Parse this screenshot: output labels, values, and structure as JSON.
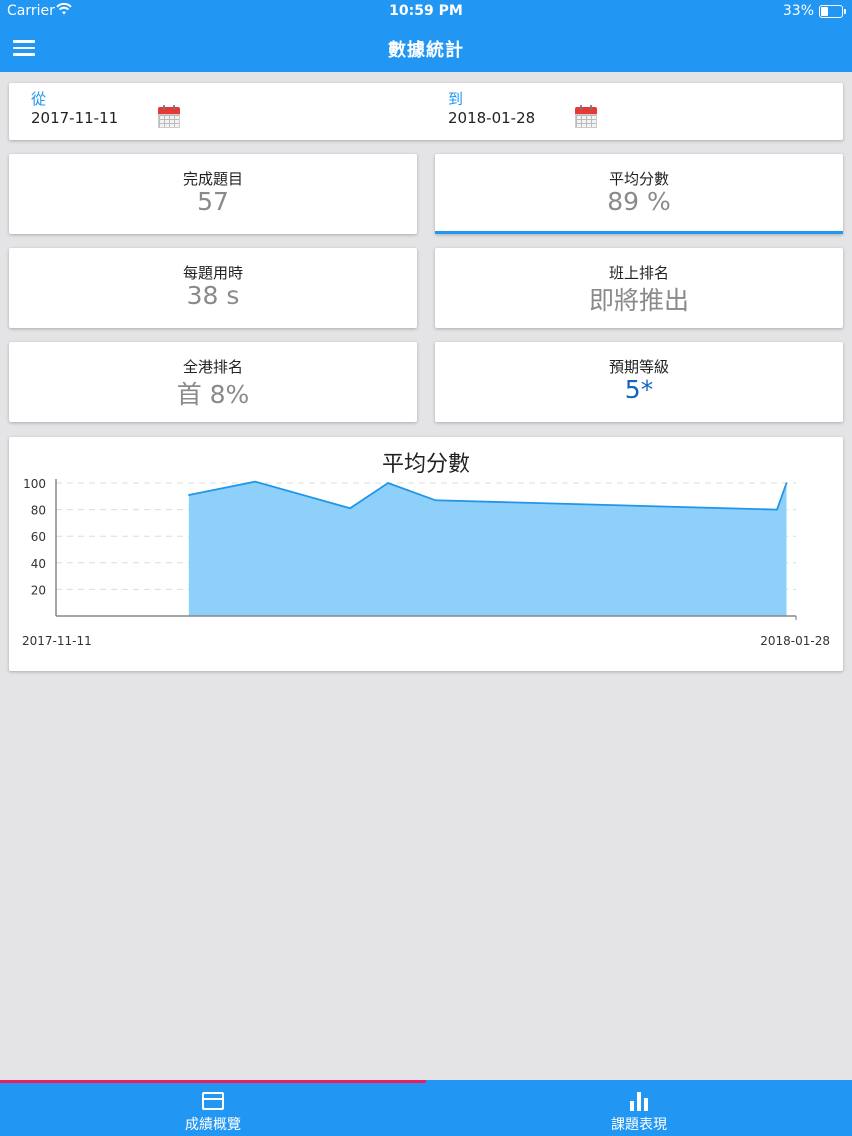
{
  "status_bar": {
    "carrier": "Carrier",
    "time": "10:59 PM",
    "battery": "33%"
  },
  "header": {
    "title": "數據統計"
  },
  "date_range": {
    "from_label": "從",
    "from_value": "2017-11-11",
    "to_label": "到",
    "to_value": "2018-01-28"
  },
  "stats": [
    {
      "label": "完成題目",
      "value": "57"
    },
    {
      "label": "平均分數",
      "value": "89 %"
    },
    {
      "label": "每題用時",
      "value": "38 s"
    },
    {
      "label": "班上排名",
      "value": "即將推出"
    },
    {
      "label": "全港排名",
      "value": "首 8%"
    },
    {
      "label": "預期等級",
      "value": "5*"
    }
  ],
  "colors": {
    "primary": "#2196f3",
    "tab_indicator": "#e91e63",
    "area_fill": "#8ed0fa",
    "area_line": "#2196e8",
    "grade_blue": "#1565c0"
  },
  "chart_data": {
    "type": "area",
    "title": "平均分數",
    "x_start_label": "2017-11-11",
    "x_end_label": "2018-01-28",
    "x": [
      "2017-11-25",
      "2017-12-02",
      "2017-12-12",
      "2017-12-16",
      "2017-12-21",
      "2018-01-26",
      "2018-01-27"
    ],
    "y": [
      91,
      101,
      81,
      100,
      87,
      80,
      100
    ],
    "y_ticks": [
      20,
      40,
      60,
      80,
      100
    ],
    "ylim": [
      0,
      100
    ],
    "grid": "horizontal dashed"
  },
  "tabs": [
    {
      "label": "成績概覽",
      "icon": "overview-icon",
      "active": true
    },
    {
      "label": "課題表現",
      "icon": "bar-chart-icon",
      "active": false
    }
  ]
}
